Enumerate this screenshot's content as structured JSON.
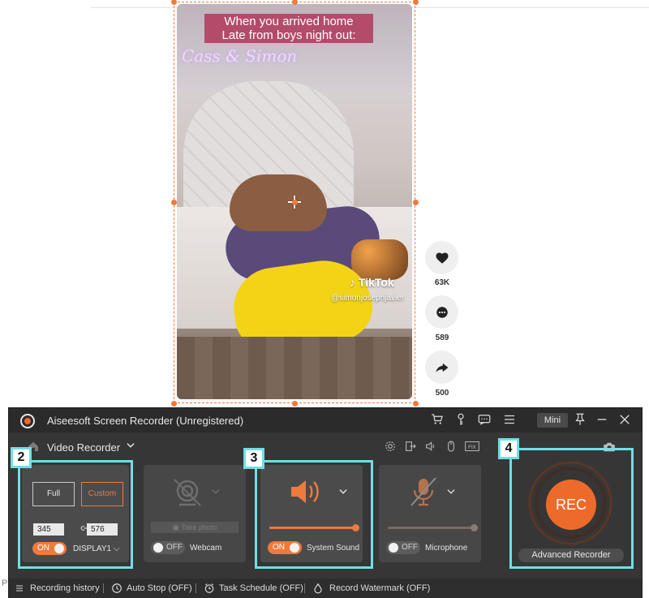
{
  "video": {
    "caption_line1": "When you arrived home",
    "caption_line2": "Late from boys night out:",
    "neon_sign": "Cass & Simon",
    "platform_logo": "TikTok",
    "username": "@simonjosephjavier"
  },
  "tiktok_actions": [
    {
      "icon": "heart-icon",
      "count": "63K"
    },
    {
      "icon": "comment-icon",
      "count": "589"
    },
    {
      "icon": "share-icon",
      "count": "500"
    }
  ],
  "web_page": {
    "corner_text": "P"
  },
  "recorder": {
    "title": "Aiseesoft Screen Recorder (Unregistered)",
    "mini_label": "Mini",
    "mode_label": "Video Recorder",
    "display_panel": {
      "full_label": "Full",
      "custom_label": "Custom",
      "width_value": "345",
      "height_value": "576",
      "toggle_label": "ON",
      "display_label": "DISPLAY1"
    },
    "webcam_panel": {
      "take_photo_label": "Take photo",
      "toggle_label": "OFF",
      "label": "Webcam"
    },
    "sound_panel": {
      "toggle_label": "ON",
      "label": "System Sound",
      "volume_fraction": 1.0
    },
    "mic_panel": {
      "toggle_label": "OFF",
      "label": "Microphone",
      "volume_fraction": 1.0
    },
    "rec_label": "REC",
    "advanced_label": "Advanced Recorder",
    "status": {
      "history": "Recording history",
      "auto_stop": "Auto Stop (OFF)",
      "task_schedule": "Task Schedule (OFF)",
      "watermark": "Record Watermark (OFF)"
    }
  },
  "annotations": {
    "badge2": "2",
    "badge3": "3",
    "badge4": "4",
    "highlight_color": "#6fdfe6"
  },
  "colors": {
    "accent": "#ee7a3c",
    "rec": "#ee6a2a",
    "window_bg": "#363636"
  }
}
